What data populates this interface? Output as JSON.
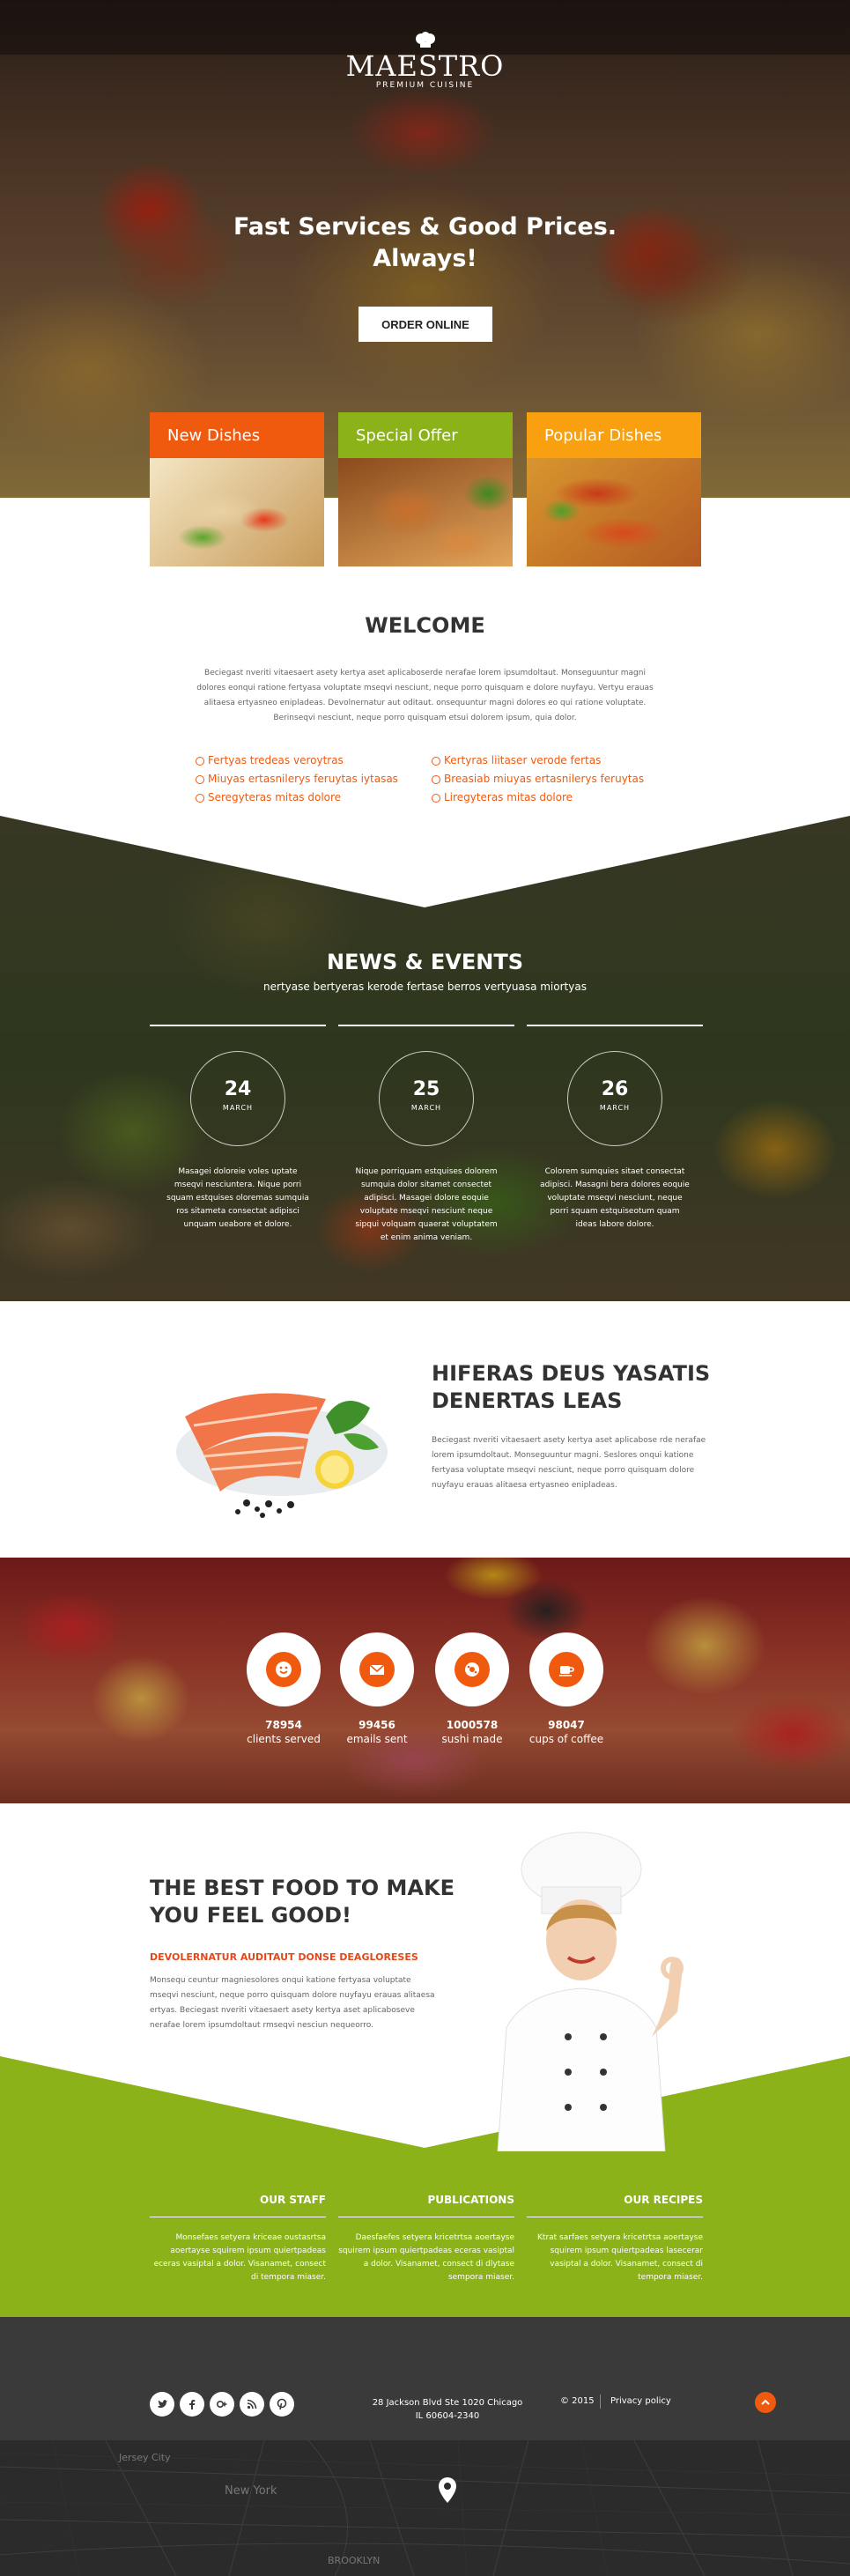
{
  "brand": {
    "name": "MAESTRO",
    "tagline": "PREMIUM CUISINE"
  },
  "hero": {
    "title": "Fast Services & Good Prices. Always!",
    "cta": "ORDER ONLINE"
  },
  "categories": [
    {
      "label": "New Dishes",
      "color": "#f05a0e"
    },
    {
      "label": "Special Offer",
      "color": "#8cb219"
    },
    {
      "label": "Popular Dishes",
      "color": "#f8a010"
    }
  ],
  "welcome": {
    "title": "WELCOME",
    "text": "Beciegast nveriti vitaesaert asety kertya aset aplicaboserde nerafae lorem ipsumdoltaut. Monseguuntur magni dolores eonqui ratione fertyasa voluptate mseqvi nesciunt, neque porro quisquam e dolore nuyfayu. Vertyu erauas alitaesa ertyasneo enipladeas. Devolnernatur aut oditaut. onsequuntur magni dolores eo qui ratione voluptate. Berinseqvi nesciunt, neque porro quisquam etsui dolorem ipsum, quia dolor.",
    "list_left": [
      "Fertyas tredeas veroytras",
      "Miuyas ertasnilerys feruytas iytasas",
      "Seregyteras mitas dolore"
    ],
    "list_right": [
      "Kertyras liitaser verode fertas",
      "Breasiab miuyas ertasnilerys feruytas",
      "Liregyteras mitas dolore"
    ]
  },
  "news": {
    "title": "NEWS & EVENTS",
    "subtitle": "nertyase bertyeras kerode fertase berros vertyuasa miortyas",
    "items": [
      {
        "day": "24",
        "month": "MARCH",
        "text": "Masagei doloreie voles uptate mseqvi nesciuntera. Nique porri squam estquises oloremas sumquia ros sitameta consectat adipisci unquam ueabore et dolore."
      },
      {
        "day": "25",
        "month": "MARCH",
        "text": "Nique porriquam estquises dolorem sumquia dolor sitamet consectet adipisci. Masagei dolore eoquie voluptate mseqvi nesciunt neque sipqui volquam quaerat voluptatem et enim anima veniam."
      },
      {
        "day": "26",
        "month": "MARCH",
        "text": "Colorem sumquies sitaet consectat adipisci. Masagni bera dolores eoquie voluptate mseqvi nesciunt, neque porri squam estquiseotum quam ideas labore dolore."
      }
    ]
  },
  "feature": {
    "title": "HIFERAS DEUS YASATIS DENERTAS LEAS",
    "text": "Beciegast nveriti vitaesaert asety kertya aset aplicabose rde nerafae lorem ipsumdoltaut. Monseguuntur magni. Seslores onqui katione fertyasa voluptate mseqvi nesciunt, neque porro quisquam dolore nuyfayu erauas alitaesa ertyasneo enipladeas."
  },
  "stats": [
    {
      "value": "78954",
      "label": "clients served",
      "icon": "smiley-icon"
    },
    {
      "value": "99456",
      "label": "emails sent",
      "icon": "envelope-icon"
    },
    {
      "value": "1000578",
      "label": "sushi made",
      "icon": "sushi-icon"
    },
    {
      "value": "98047",
      "label": "cups of coffee",
      "icon": "coffee-cup-icon"
    }
  ],
  "best": {
    "title": "THE BEST FOOD TO MAKE YOU FEEL GOOD!",
    "subtitle": "DEVOLERNATUR AUDITAUT DONSE DEAGLORESES",
    "text": "Monsequ ceuntur magniesolores onqui katione fertyasa voluptate mseqvi nesciunt, neque porro quisquam dolore nuyfayu erauas alitaesa ertyas. Beciegast nveriti vitaesaert asety kertya aset aplicaboseve nerafae lorem ipsumdoltaut rmseqvi nesciun nequeorro."
  },
  "info_columns": [
    {
      "title": "OUR STAFF",
      "text": "Monsefaes setyera kriceae oustasrtsa aoertayse squirem ipsum quiertpadeas eceras vasiptal a dolor. Visanamet, consect di tempora miaser."
    },
    {
      "title": "PUBLICATIONS",
      "text": "Daesfaefes setyera kricetrtsa aoertayse squirem ipsum quiertpadeas eceras vasiptal a dolor. Visanamet, consect di dlytase sempora miaser."
    },
    {
      "title": "OUR RECIPES",
      "text": "Ktrat sarfaes setyera kricetrtsa aoertayse squirem ipsum quiertpadeas lasecerar vasiptal a dolor. Visanamet, consect di tempora miaser."
    }
  ],
  "footer": {
    "social": [
      "twitter-icon",
      "facebook-icon",
      "google-plus-icon",
      "rss-icon",
      "pinterest-icon"
    ],
    "address_line1": "28 Jackson Blvd Ste 1020 Chicago",
    "address_line2": "IL 60604-2340",
    "copyright": "© 2015",
    "privacy": "Privacy policy"
  },
  "map": {
    "labels": [
      "Jersey City",
      "New York",
      "BROOKLYN"
    ]
  },
  "colors": {
    "orange": "#f05a0e",
    "green": "#8cb219",
    "yellow": "#f8a010",
    "footer": "#3a3a3a",
    "map": "#2b2b2b"
  }
}
